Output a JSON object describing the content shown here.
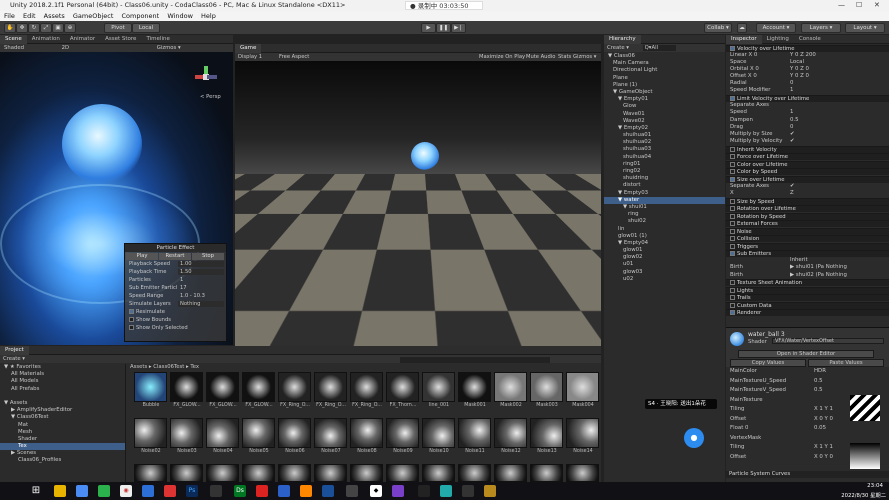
{
  "title": "Unity 2018.2.1f1 Personal (64bit) - Class06.unity - CodaClass06 - PC, Mac & Linux Standalone <DX11>",
  "recording": "● 录制中 03:03:50",
  "menu": [
    "File",
    "Edit",
    "Assets",
    "GameObject",
    "Component",
    "Window",
    "Help"
  ],
  "toolbar": {
    "pivot": "Pivot",
    "local": "Local",
    "collab": "Collab ▾",
    "account": "Account ▾",
    "layers": "Layers ▾",
    "layout": "Layout ▾"
  },
  "scene": {
    "tabs": [
      "Scene",
      "Animation",
      "Animator",
      "Asset Store",
      "Timeline"
    ],
    "shaded": "Shaded",
    "mode": "2D",
    "gizmos": "Gizmos ▾",
    "persp": "< Persp"
  },
  "game": {
    "tab": "Game",
    "display": "Display 1",
    "aspect": "Free Aspect",
    "maximize": "Maximize On Play",
    "mute": "Mute Audio",
    "stats": "Stats",
    "gizmos": "Gizmos ▾"
  },
  "particle_effect": {
    "title": "Particle Effect",
    "buttons": [
      "Play",
      "Restart",
      "Stop"
    ],
    "rows": [
      {
        "label": "Playback Speed",
        "value": "1.00"
      },
      {
        "label": "Playback Time",
        "value": "1.50"
      },
      {
        "label": "Particles",
        "value": "1"
      },
      {
        "label": "Sub Emitter Particl",
        "value": "17"
      },
      {
        "label": "Speed Range",
        "value": "1.0 - 10.3"
      },
      {
        "label": "Simulate Layers",
        "value": "Nothing"
      }
    ],
    "checks": [
      "Resimulate",
      "Show Bounds",
      "Show Only Selected"
    ]
  },
  "hierarchy": {
    "tab": "Hierarchy",
    "create": "Create ▾",
    "search": "Q▾All",
    "items": [
      {
        "t": "▼ Class06",
        "d": 0
      },
      {
        "t": "Main Camera",
        "d": 1
      },
      {
        "t": "Directional Light",
        "d": 1
      },
      {
        "t": "Plane",
        "d": 1
      },
      {
        "t": "Plane (1)",
        "d": 1
      },
      {
        "t": "▼ GameObject",
        "d": 1
      },
      {
        "t": "▼ Empty01",
        "d": 2
      },
      {
        "t": "Glow",
        "d": 3
      },
      {
        "t": "Wave01",
        "d": 3
      },
      {
        "t": "Wave02",
        "d": 3
      },
      {
        "t": "▼ Empty02",
        "d": 2
      },
      {
        "t": "shuihua01",
        "d": 3
      },
      {
        "t": "shuihua02",
        "d": 3
      },
      {
        "t": "shuihua03",
        "d": 3
      },
      {
        "t": "shuihua04",
        "d": 3
      },
      {
        "t": "ring01",
        "d": 3
      },
      {
        "t": "ring02",
        "d": 3
      },
      {
        "t": "shuidring",
        "d": 3
      },
      {
        "t": "distort",
        "d": 3
      },
      {
        "t": "▼ Empty03",
        "d": 2
      },
      {
        "t": "▼ water",
        "d": 2,
        "sel": true
      },
      {
        "t": "▼ shui01",
        "d": 3
      },
      {
        "t": "ring",
        "d": 4
      },
      {
        "t": "shui02",
        "d": 4
      },
      {
        "t": "lin",
        "d": 2
      },
      {
        "t": "glow01 (1)",
        "d": 2
      },
      {
        "t": "▼ Empty04",
        "d": 2
      },
      {
        "t": "glow01",
        "d": 3
      },
      {
        "t": "glow02",
        "d": 3
      },
      {
        "t": "u01",
        "d": 3
      },
      {
        "t": "glow03",
        "d": 3
      },
      {
        "t": "u02",
        "d": 3
      }
    ]
  },
  "inspector": {
    "tabs": [
      "Inspector",
      "Lighting",
      "Console"
    ],
    "lines": [
      {
        "k": "chk",
        "t": "Velocity over Lifetime"
      },
      {
        "k": "kv",
        "t": "Linear  X  0",
        "v": "Y  0    Z  200"
      },
      {
        "k": "kv",
        "t": "Space",
        "v": "Local"
      },
      {
        "k": "kv",
        "t": "Orbital  X  0",
        "v": "Y  0    Z  0"
      },
      {
        "k": "kv",
        "t": "Offset  X  0",
        "v": "Y  0    Z  0"
      },
      {
        "k": "kv",
        "t": "Radial",
        "v": "0"
      },
      {
        "k": "kv",
        "t": "Speed Modifier",
        "v": "1"
      },
      {
        "k": "chk",
        "t": "Limit Velocity over Lifetime"
      },
      {
        "k": "kv",
        "t": "Separate Axes",
        "v": ""
      },
      {
        "k": "kv",
        "t": "Speed",
        "v": "1"
      },
      {
        "k": "kv",
        "t": "  Dampen",
        "v": "0.5"
      },
      {
        "k": "kv",
        "t": "Drag",
        "v": "0"
      },
      {
        "k": "kv",
        "t": "  Multiply by Size",
        "v": "✔"
      },
      {
        "k": "kv",
        "t": "  Multiply by Velocity",
        "v": "✔"
      },
      {
        "k": "sect",
        "t": "Inherit Velocity"
      },
      {
        "k": "sect",
        "t": "Force over Lifetime"
      },
      {
        "k": "sect",
        "t": "Color over Lifetime"
      },
      {
        "k": "sect",
        "t": "Color by Speed"
      },
      {
        "k": "chk",
        "t": "Size over Lifetime"
      },
      {
        "k": "kv",
        "t": "Separate Axes",
        "v": "✔"
      },
      {
        "k": "kv",
        "t": "X",
        "v": "Z"
      },
      {
        "k": "sect",
        "t": "Size by Speed"
      },
      {
        "k": "sect",
        "t": "Rotation over Lifetime"
      },
      {
        "k": "sect",
        "t": "Rotation by Speed"
      },
      {
        "k": "sect",
        "t": "External Forces"
      },
      {
        "k": "sect",
        "t": "Noise"
      },
      {
        "k": "sect",
        "t": "Collision"
      },
      {
        "k": "sect",
        "t": "Triggers"
      },
      {
        "k": "chk",
        "t": "Sub Emitters"
      },
      {
        "k": "kv",
        "t": "",
        "v": "Inherit"
      },
      {
        "k": "kv",
        "t": "Birth",
        "v": "▶ shui01 (Pa  Nothing"
      },
      {
        "k": "kv",
        "t": "Birth",
        "v": "▶ shui02 (Pa  Nothing"
      },
      {
        "k": "sect",
        "t": "Texture Sheet Animation"
      },
      {
        "k": "sect",
        "t": "Lights"
      },
      {
        "k": "sect",
        "t": "Trails"
      },
      {
        "k": "sect",
        "t": "Custom Data"
      },
      {
        "k": "chk",
        "t": "Renderer"
      }
    ],
    "material": {
      "name": "water_ball 3",
      "shader_label": "Shader",
      "shader": "VFX/Water/VertexOffset",
      "open": "Open in Shader Editor",
      "copy": "Copy Values",
      "paste": "Paste Values",
      "props": [
        {
          "t": "MainColor",
          "v": "HDR"
        },
        {
          "t": "MainTextureU_Speed",
          "v": "0.5"
        },
        {
          "t": "MainTextureV_Speed",
          "v": "0.5"
        },
        {
          "t": "MainTexture",
          "v": ""
        },
        {
          "t": "   Tiling",
          "v": "X 1   Y 1"
        },
        {
          "t": "   Offset",
          "v": "X 0   Y 0"
        },
        {
          "t": "Float 0",
          "v": "0.05"
        },
        {
          "t": "VertexMask",
          "v": ""
        },
        {
          "t": "   Tiling",
          "v": "X 1   Y 1"
        },
        {
          "t": "   Offset",
          "v": "X 0   Y 0"
        }
      ],
      "select": "Select",
      "curves": "Particle System Curves"
    }
  },
  "project": {
    "tab": "Project",
    "create": "Create ▾",
    "breadcrumb": "Assets ▸ Class06Test ▸ Tex",
    "tree": [
      {
        "t": "▼ ★ Favorites",
        "d": 0
      },
      {
        "t": "All Materials",
        "d": 1
      },
      {
        "t": "All Models",
        "d": 1
      },
      {
        "t": "All Prefabs",
        "d": 1
      },
      {
        "t": "",
        "d": 0
      },
      {
        "t": "▼ Assets",
        "d": 0
      },
      {
        "t": "▶ AmplifyShaderEditor",
        "d": 1
      },
      {
        "t": "▼ Class06Test",
        "d": 1
      },
      {
        "t": "Mat",
        "d": 2
      },
      {
        "t": "Mesh",
        "d": 2
      },
      {
        "t": "Shader",
        "d": 2
      },
      {
        "t": "Tex",
        "d": 2,
        "sel": true
      },
      {
        "t": "▶ Scenes",
        "d": 1
      },
      {
        "t": "Class06_Profiles",
        "d": 2
      }
    ],
    "row1": [
      "Bubble",
      "FX_GLOW...",
      "FX_GLOW...",
      "FX_GLOW...",
      "FX_Ring_O...",
      "FX_Ring_O...",
      "FX_Ring_O...",
      "FX_Thorn...",
      "line_001",
      "Mask001",
      "Mask002",
      "Mask003",
      "Mask004"
    ],
    "row2": [
      "Noise02",
      "Noise03",
      "Noise04",
      "Noise05",
      "Noise06",
      "Noise07",
      "Noise08",
      "Noise09",
      "Noise10",
      "Noise11",
      "Noise12",
      "Noise13",
      "Noise14"
    ]
  },
  "subtitle": "S4 · 王晓阳: 送出1朵花",
  "taskbar": {
    "time": "23:04",
    "date": "2022/8/30 星期二"
  }
}
